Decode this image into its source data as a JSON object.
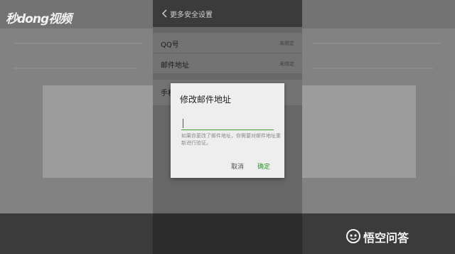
{
  "header": {
    "title": "更多安全设置"
  },
  "rows": [
    {
      "label": "QQ号",
      "value": "未绑定"
    },
    {
      "label": "邮件地址",
      "value": "未绑定"
    },
    {
      "label": "手机"
    }
  ],
  "dialog": {
    "title": "修改邮件地址",
    "input_value": "",
    "hint": "如果你更改了邮件地址，你需要对邮件地址重新进行验证。",
    "cancel_label": "取消",
    "ok_label": "确定",
    "accent_color": "#2f9a2a"
  },
  "watermarks": {
    "left": "秒dong视频",
    "right": "悟空问答"
  },
  "icons": [
    "back-chevron-icon",
    "wukong-logo-icon"
  ]
}
